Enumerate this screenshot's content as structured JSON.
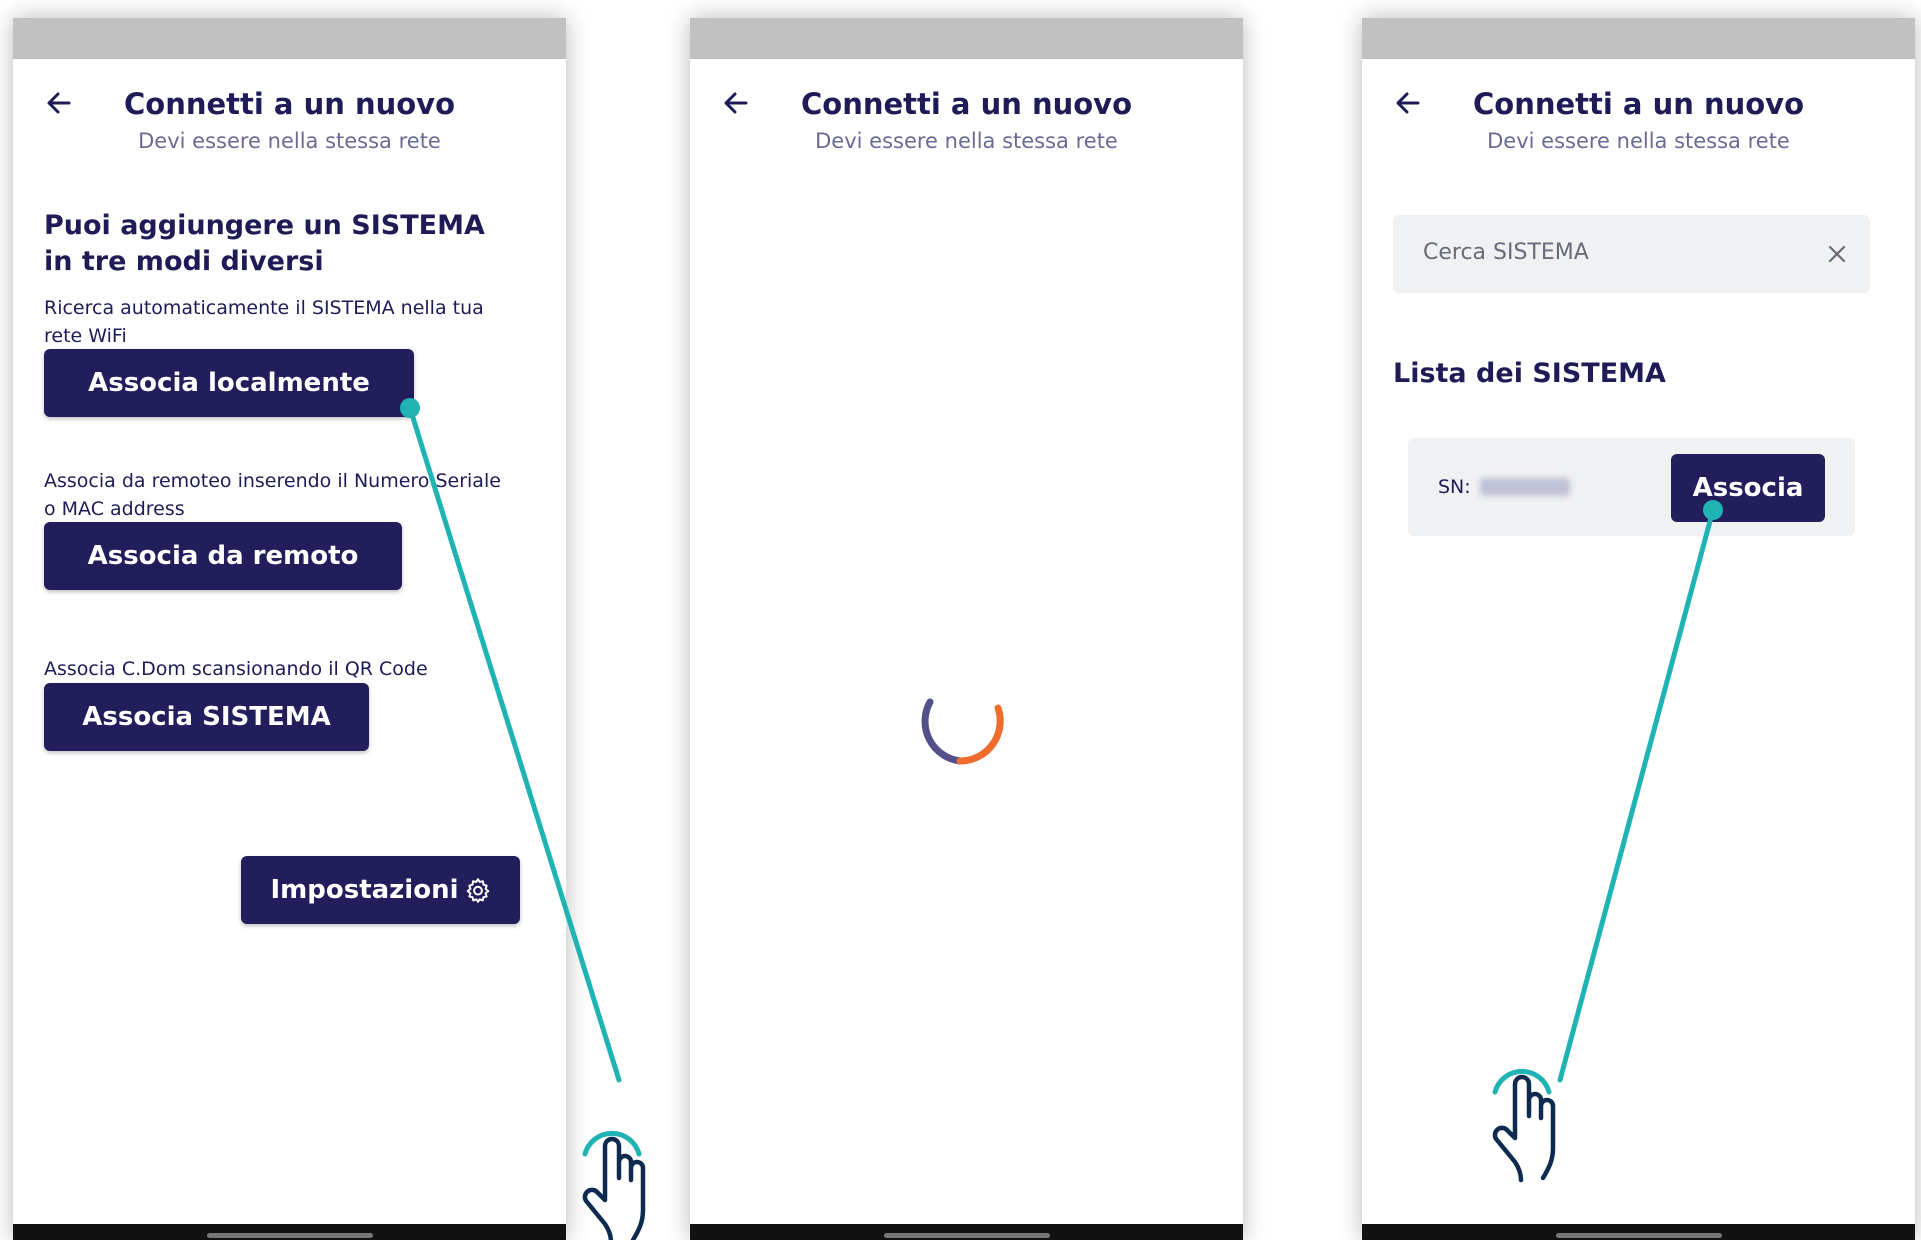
{
  "screens": [
    {
      "header": {
        "title": "Connetti a un nuovo",
        "subtitle": "Devi essere nella stessa rete"
      },
      "intro_title_line1": "Puoi aggiungere un SISTEMA",
      "intro_title_line2": "in tre modi diversi",
      "option_local": {
        "description_line1": "Ricerca automaticamente il SISTEMA  nella tua",
        "description_line2": "rete WiFi",
        "button": "Associa localmente"
      },
      "option_remote": {
        "description_line1": "Associa da remoteo inserendo il Numero Seriale",
        "description_line2": "o MAC address",
        "button": "Associa da remoto"
      },
      "option_qr": {
        "description": "Associa C.Dom scansionando il QR Code",
        "button": "Associa SISTEMA"
      },
      "settings_button": "Impostazioni",
      "settings_icon": "gear-icon"
    },
    {
      "header": {
        "title": "Connetti a un nuovo",
        "subtitle": "Devi essere nella stessa rete"
      },
      "loading_icon": "spinner-icon"
    },
    {
      "header": {
        "title": "Connetti a un nuovo",
        "subtitle": "Devi essere nella stessa rete"
      },
      "search": {
        "placeholder": "Cerca SISTEMA",
        "clear_icon": "close-icon"
      },
      "list_title": "Lista dei SISTEMA",
      "device": {
        "sn_label": "SN:",
        "associate_button": "Associa"
      }
    }
  ],
  "colors": {
    "primary": "#221e5c",
    "text": "#1f1b57",
    "subtitle": "#6c6a94",
    "accent_teal": "#1fb3b3",
    "spinner_orange": "#ef6c2c",
    "spinner_purple": "#54518a",
    "status_bar": "#c1c1c1"
  }
}
